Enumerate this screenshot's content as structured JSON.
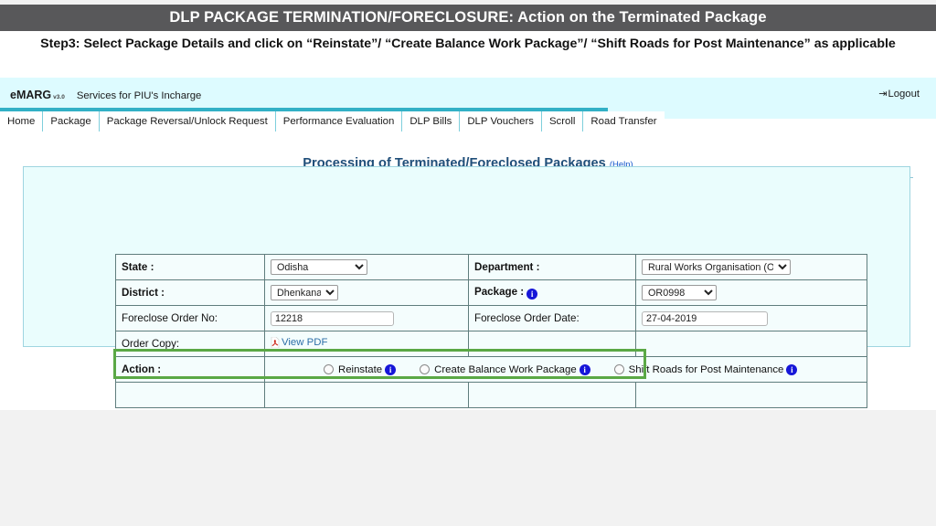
{
  "slide": {
    "title": "DLP PACKAGE TERMINATION/FORECLOSURE: Action on the Terminated Package",
    "subtitle": "Step3: Select Package Details and click on “Reinstate”/ “Create Balance Work Package”/ “Shift Roads for Post Maintenance” as applicable",
    "header_bg": "#58585a"
  },
  "site": {
    "brand_name": "eMARG",
    "brand_version": "v3.0",
    "tagline": "Services for PIU's Incharge",
    "logout_label": "Logout",
    "logout_icon": "logout-icon",
    "accent": "#32b0c6",
    "header_bg": "#ddfbff"
  },
  "nav": {
    "items": [
      {
        "label": "Home"
      },
      {
        "label": "Package"
      },
      {
        "label": "Package Reversal/Unlock Request"
      },
      {
        "label": "Performance Evaluation"
      },
      {
        "label": "DLP Bills"
      },
      {
        "label": "DLP Vouchers"
      },
      {
        "label": "Scroll"
      },
      {
        "label": "Road Transfer"
      }
    ]
  },
  "content": {
    "page_title": "Processing of Terminated/Foreclosed Packages",
    "help_label": "(Help)",
    "title_color": "#1f4e79"
  },
  "form": {
    "state": {
      "label": "State :",
      "value": "Odisha"
    },
    "department": {
      "label": "Department :",
      "value": "Rural Works Organisation (Odisha)"
    },
    "district": {
      "label": "District :",
      "value": "Dhenkanal"
    },
    "package": {
      "label": "Package :",
      "value": "OR0998",
      "info_icon": "info-icon"
    },
    "foreclose_order_no": {
      "label": "Foreclose Order No:",
      "value": "12218"
    },
    "foreclose_order_date": {
      "label": "Foreclose Order Date:",
      "value": "27-04-2019"
    },
    "order_copy": {
      "label": "Order Copy:",
      "link_label": "View PDF",
      "icon": "pdf-icon"
    },
    "action": {
      "label": "Action :",
      "options": [
        {
          "label": "Reinstate",
          "selected": false,
          "info_icon": "info-icon"
        },
        {
          "label": "Create Balance Work Package",
          "selected": false,
          "info_icon": "info-icon"
        },
        {
          "label": "Shift Roads for Post Maintenance",
          "selected": false,
          "info_icon": "info-icon"
        }
      ]
    }
  },
  "annotation": {
    "highlight_color": "#5aa845"
  }
}
